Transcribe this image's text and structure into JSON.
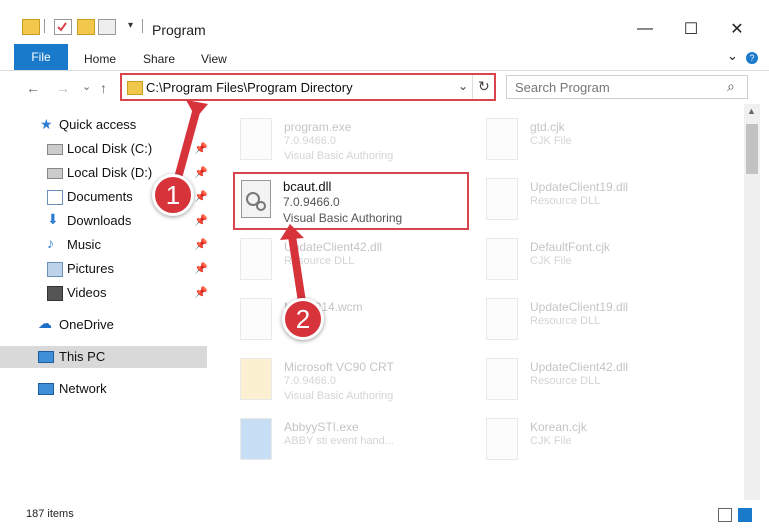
{
  "window": {
    "title": "Program",
    "minimize": "—",
    "maximize": "☐",
    "close": "✕"
  },
  "ribbon": {
    "file": "File",
    "tabs": [
      "Home",
      "Share",
      "View"
    ],
    "expand": "⌄",
    "help": "?"
  },
  "nav": {
    "back": "←",
    "forward": "→",
    "recent": "⌄",
    "up": "↑",
    "address": "C:\\Program Files\\Program Directory",
    "address_dropdown": "⌄",
    "refresh": "↻",
    "search_placeholder": "Search Program",
    "search_icon": "⌕"
  },
  "sidebar": {
    "items": [
      {
        "label": "Quick access",
        "icon": "star-icon",
        "pinned": false
      },
      {
        "label": "Local Disk (C:)",
        "icon": "drive-icon",
        "pinned": true
      },
      {
        "label": "Local Disk (D:)",
        "icon": "drive-icon",
        "pinned": true
      },
      {
        "label": "Documents",
        "icon": "documents-icon",
        "pinned": true
      },
      {
        "label": "Downloads",
        "icon": "download-icon",
        "pinned": true
      },
      {
        "label": "Music",
        "icon": "music-icon",
        "pinned": true
      },
      {
        "label": "Pictures",
        "icon": "pictures-icon",
        "pinned": true
      },
      {
        "label": "Videos",
        "icon": "videos-icon",
        "pinned": true
      },
      {
        "label": "OneDrive",
        "icon": "cloud-icon",
        "pinned": false
      },
      {
        "label": "This PC",
        "icon": "computer-icon",
        "pinned": false,
        "selected": true
      },
      {
        "label": "Network",
        "icon": "network-icon",
        "pinned": false
      }
    ],
    "pin_glyph": "📌"
  },
  "files": [
    {
      "name": "program.exe",
      "version": "7.0.9466.0",
      "type": "Visual Basic Authoring"
    },
    {
      "name": "gtd.cjk",
      "version": "",
      "type": "CJK File"
    },
    {
      "name": "UpdateClient19.dll",
      "version": "",
      "type": "Resource DLL"
    },
    {
      "name": "UpdateClient42.dll",
      "version": "",
      "type": "Resource DLL"
    },
    {
      "name": "DefaultFont.cjk",
      "version": "",
      "type": "CJK File"
    },
    {
      "name": "MSWP14.wcm",
      "version": "",
      "type": "File"
    },
    {
      "name": "UpdateClient19.dll",
      "version": "",
      "type": "Resource DLL"
    },
    {
      "name": "Microsoft VC90 CRT",
      "version": "7.0.9466.0",
      "type": "Visual Basic Authoring"
    },
    {
      "name": "UpdateClient42.dll",
      "version": "",
      "type": "Resource DLL"
    },
    {
      "name": "AbbyySTI.exe",
      "version": "",
      "type": "ABBY sti event hand..."
    },
    {
      "name": "Korean.cjk",
      "version": "",
      "type": "CJK File"
    }
  ],
  "highlighted_file": {
    "name": "bcaut.dll",
    "version": "7.0.9466.0",
    "type": "Visual Basic Authoring"
  },
  "callouts": [
    "1",
    "2"
  ],
  "status": {
    "items": "187 items"
  },
  "colors": {
    "accent": "#1979ca",
    "highlight": "#d9454d",
    "callout": "#d6333b"
  }
}
